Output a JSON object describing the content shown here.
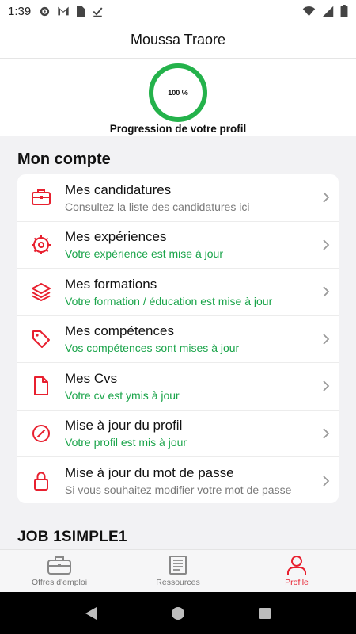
{
  "status_bar": {
    "time": "1:39",
    "left_icons": [
      "gear-icon",
      "gmail-icon",
      "sim-icon",
      "check-icon"
    ],
    "right_icons": [
      "wifi-icon",
      "signal-icon",
      "battery-icon"
    ]
  },
  "header": {
    "title": "Moussa Traore"
  },
  "profile_progress": {
    "value_text": "100 %",
    "value": 1.0,
    "label": "Progression de votre profil",
    "ring_color": "#24b24b"
  },
  "account": {
    "title": "Mon compte",
    "items": [
      {
        "icon": "briefcase-icon",
        "label": "Mes candidatures",
        "sub": "Consultez la liste des candidatures ici",
        "sub_status": "gray"
      },
      {
        "icon": "gear-badge-icon",
        "label": "Mes expériences",
        "sub": "Votre expérience est mise à jour",
        "sub_status": "green"
      },
      {
        "icon": "layers-icon",
        "label": "Mes formations",
        "sub": "Votre formation / éducation est mise à jour",
        "sub_status": "green"
      },
      {
        "icon": "tag-icon",
        "label": "Mes compétences",
        "sub": "Vos compétences sont mises à jour",
        "sub_status": "green"
      },
      {
        "icon": "file-icon",
        "label": "Mes Cvs",
        "sub": "Votre cv est ymis à jour",
        "sub_status": "green"
      },
      {
        "icon": "compass-icon",
        "label": "Mise à jour du profil",
        "sub": "Votre profil est mis à jour",
        "sub_status": "green"
      },
      {
        "icon": "lock-icon",
        "label": "Mise à jour du mot de passe",
        "sub": "Si vous souhaitez modifier votre mot de passe",
        "sub_status": "gray"
      }
    ]
  },
  "section2": {
    "title": "JOB 1SIMPLE1"
  },
  "bottom_nav": {
    "items": [
      {
        "icon": "briefcase-icon",
        "label": "Offres d'emploi",
        "active": false
      },
      {
        "icon": "document-list-icon",
        "label": "Ressources",
        "active": false
      },
      {
        "icon": "user-icon",
        "label": "Profile",
        "active": true
      }
    ]
  },
  "colors": {
    "accent": "#e8202f",
    "success": "#1aa44a",
    "ring": "#24b24b"
  }
}
